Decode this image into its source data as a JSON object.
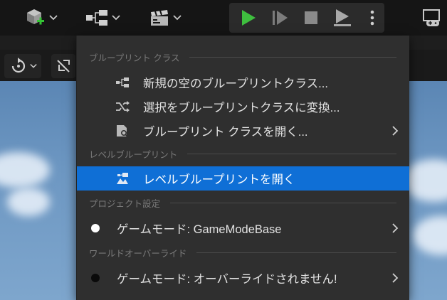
{
  "menu": {
    "sections": [
      {
        "title": "ブループリント クラス",
        "items": [
          {
            "label": "新規の空のブループリントクラス...",
            "icon": "new-blueprint-class-icon"
          },
          {
            "label": "選択をブループリントクラスに変換...",
            "icon": "convert-selection-icon"
          },
          {
            "label": "ブループリント クラスを開く...",
            "icon": "open-blueprint-class-icon",
            "submenu": true
          }
        ]
      },
      {
        "title": "レベルブループリント",
        "items": [
          {
            "label": "レベルブループリントを開く",
            "icon": "level-blueprint-icon",
            "selected": true
          }
        ]
      },
      {
        "title": "プロジェクト設定",
        "items": [
          {
            "label": "ゲームモード: GameModeBase",
            "icon": "white-dot-icon",
            "submenu": true
          }
        ]
      },
      {
        "title": "ワールドオーバーライド",
        "items": [
          {
            "label": "ゲームモード: オーバーライドされません!",
            "icon": "black-dot-icon",
            "submenu": true
          }
        ]
      }
    ]
  },
  "colors": {
    "menu_bg": "#2f2f2f",
    "selected_bg": "#0f6fd6",
    "play_green": "#3fbf3f",
    "add_green": "#35c435",
    "section_text": "#7a7a7a",
    "item_text": "#e2e2e2"
  }
}
